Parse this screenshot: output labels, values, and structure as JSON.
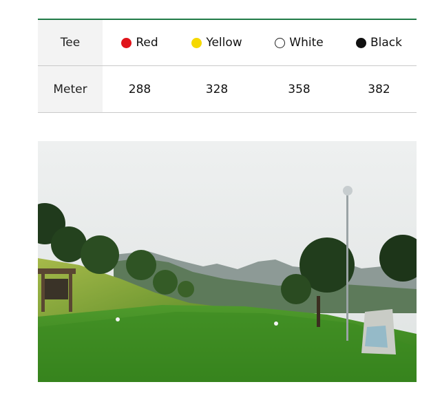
{
  "table": {
    "header_label": "Tee",
    "tees": [
      {
        "name": "Red",
        "color": "#e0141b",
        "border": "#e0141b"
      },
      {
        "name": "Yellow",
        "color": "#f5d800",
        "border": "#f5d800"
      },
      {
        "name": "White",
        "color": "#ffffff",
        "border": "#222222"
      },
      {
        "name": "Black",
        "color": "#111111",
        "border": "#111111"
      }
    ],
    "meter_label": "Meter",
    "meters": [
      "288",
      "328",
      "358",
      "382"
    ]
  },
  "colors": {
    "accent": "#1f7a46"
  }
}
